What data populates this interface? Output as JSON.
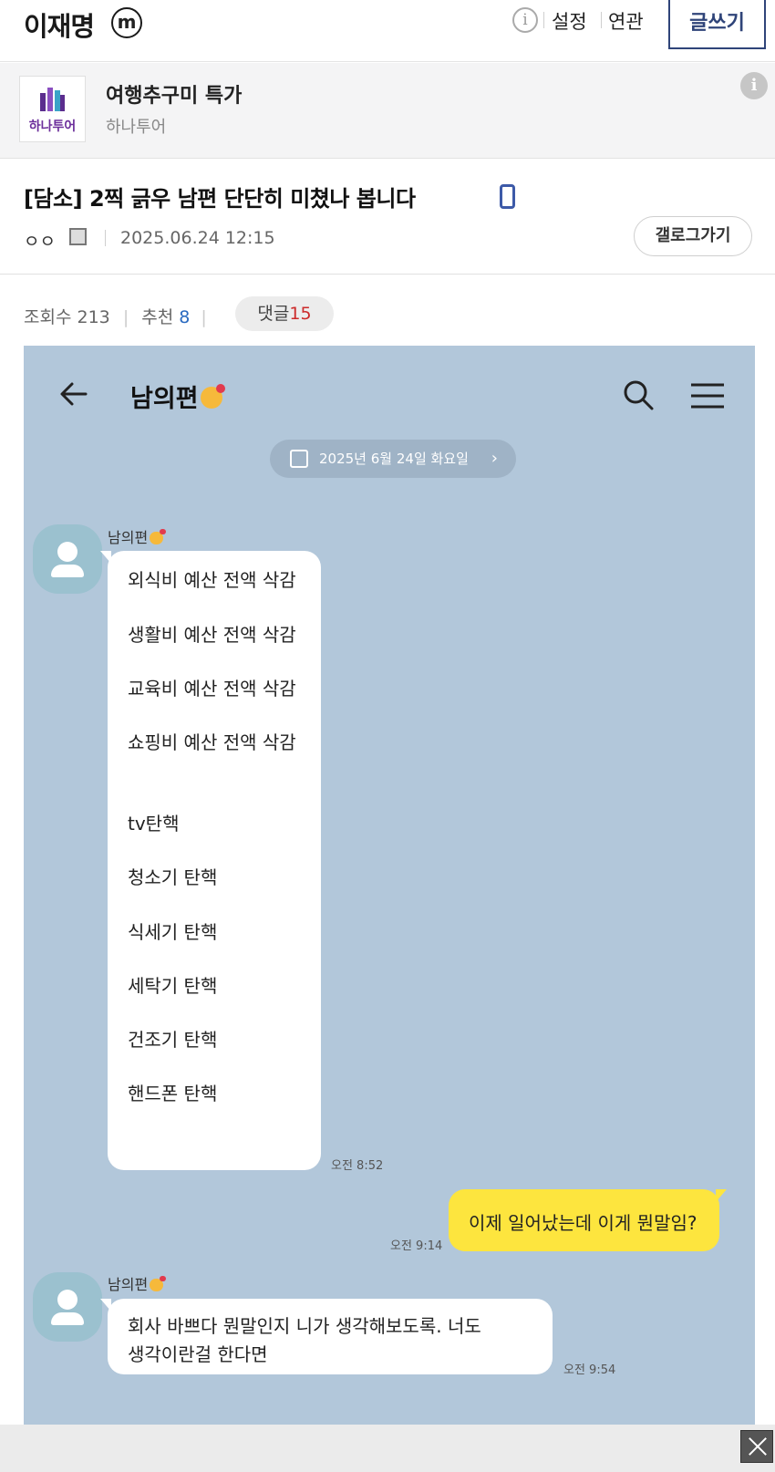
{
  "header": {
    "gallery_title": "이재명",
    "minor_badge": "m",
    "info_symbol": "i",
    "settings": "설정",
    "related": "연관",
    "write": "글쓰기"
  },
  "ad": {
    "brand": "하나투어",
    "title": "여행추구미 특가",
    "subtitle": "하나투어",
    "info_symbol": "i",
    "colors": {
      "brand": "#6c2f9b"
    }
  },
  "post": {
    "title": "[담소] 2찍 긁우 남편 단단히 미쳤나 봅니다",
    "author": "ㅇㅇ",
    "date": "2025.06.24 12:15",
    "gallery_button": "갤로그가기",
    "views_label": "조회수",
    "views": "213",
    "recommend_label": "추천",
    "recommend": "8",
    "comments_label": "댓글",
    "comments": "15"
  },
  "chat": {
    "name": "남의편",
    "date": "2025년 6월 24일 화요일",
    "messages": [
      {
        "sender": "남의편",
        "lines": [
          "외식비 예산 전액 삭감",
          "생활비 예산 전액 삭감",
          "교육비 예산 전액 삭감",
          "쇼핑비 예산 전액 삭감",
          "tv탄핵",
          "청소기 탄핵",
          "식세기 탄핵",
          "세탁기 탄핵",
          "건조기 탄핵",
          "핸드폰 탄핵"
        ],
        "time": "오전 8:52"
      },
      {
        "sender": "me",
        "lines": [
          "이제 일어났는데 이게 뭔말임?"
        ],
        "time": "오전 9:14"
      },
      {
        "sender": "남의편",
        "lines": [
          "회사 바쁘다 뭔말인지 니가 생각해보도록. 너도",
          "생각이란걸 한다면"
        ],
        "time": "오전 9:54"
      }
    ],
    "colors": {
      "background": "#b2c7da",
      "my_bubble": "#fde53e"
    }
  }
}
